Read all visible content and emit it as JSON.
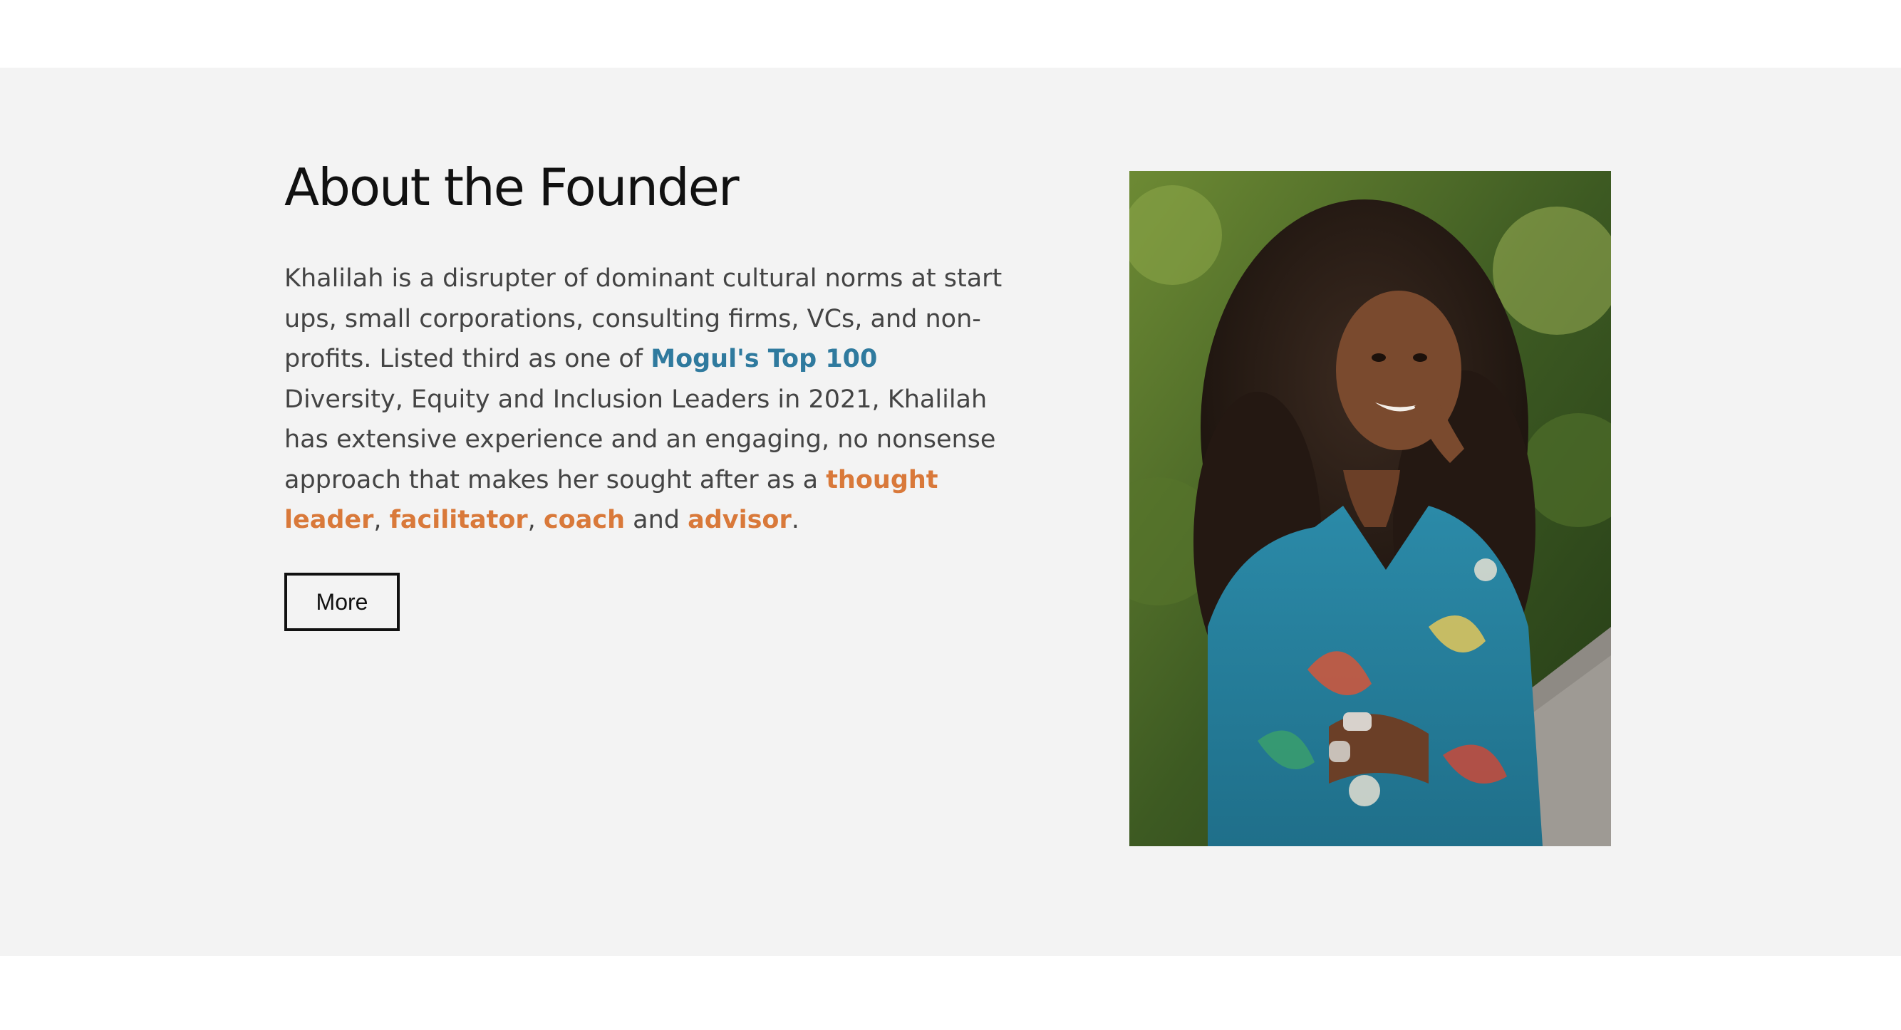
{
  "founder": {
    "heading": "About the Founder",
    "bio": {
      "intro": "Khalilah is a disrupter of dominant cultural norms at start ups, small corporations, consulting firms, VCs, and non-profits. Listed third as one of ",
      "list_link": "Mogul's Top 100",
      "middle": " Diversity, Equity and Inclusion Leaders in 2021, Khalilah has extensive experience and an engaging, no nonsense approach that makes her sought after as a ",
      "role_1": "thought leader",
      "sep_1": ", ",
      "role_2": "facilitator",
      "sep_2": ", ",
      "role_3": "coach",
      "sep_3": " and ",
      "role_4": "advisor",
      "end": "."
    },
    "more_label": "More"
  },
  "colors": {
    "section_background": "#f3f3f3",
    "link_blue": "#2f7a9e",
    "link_orange": "#d9793a"
  }
}
